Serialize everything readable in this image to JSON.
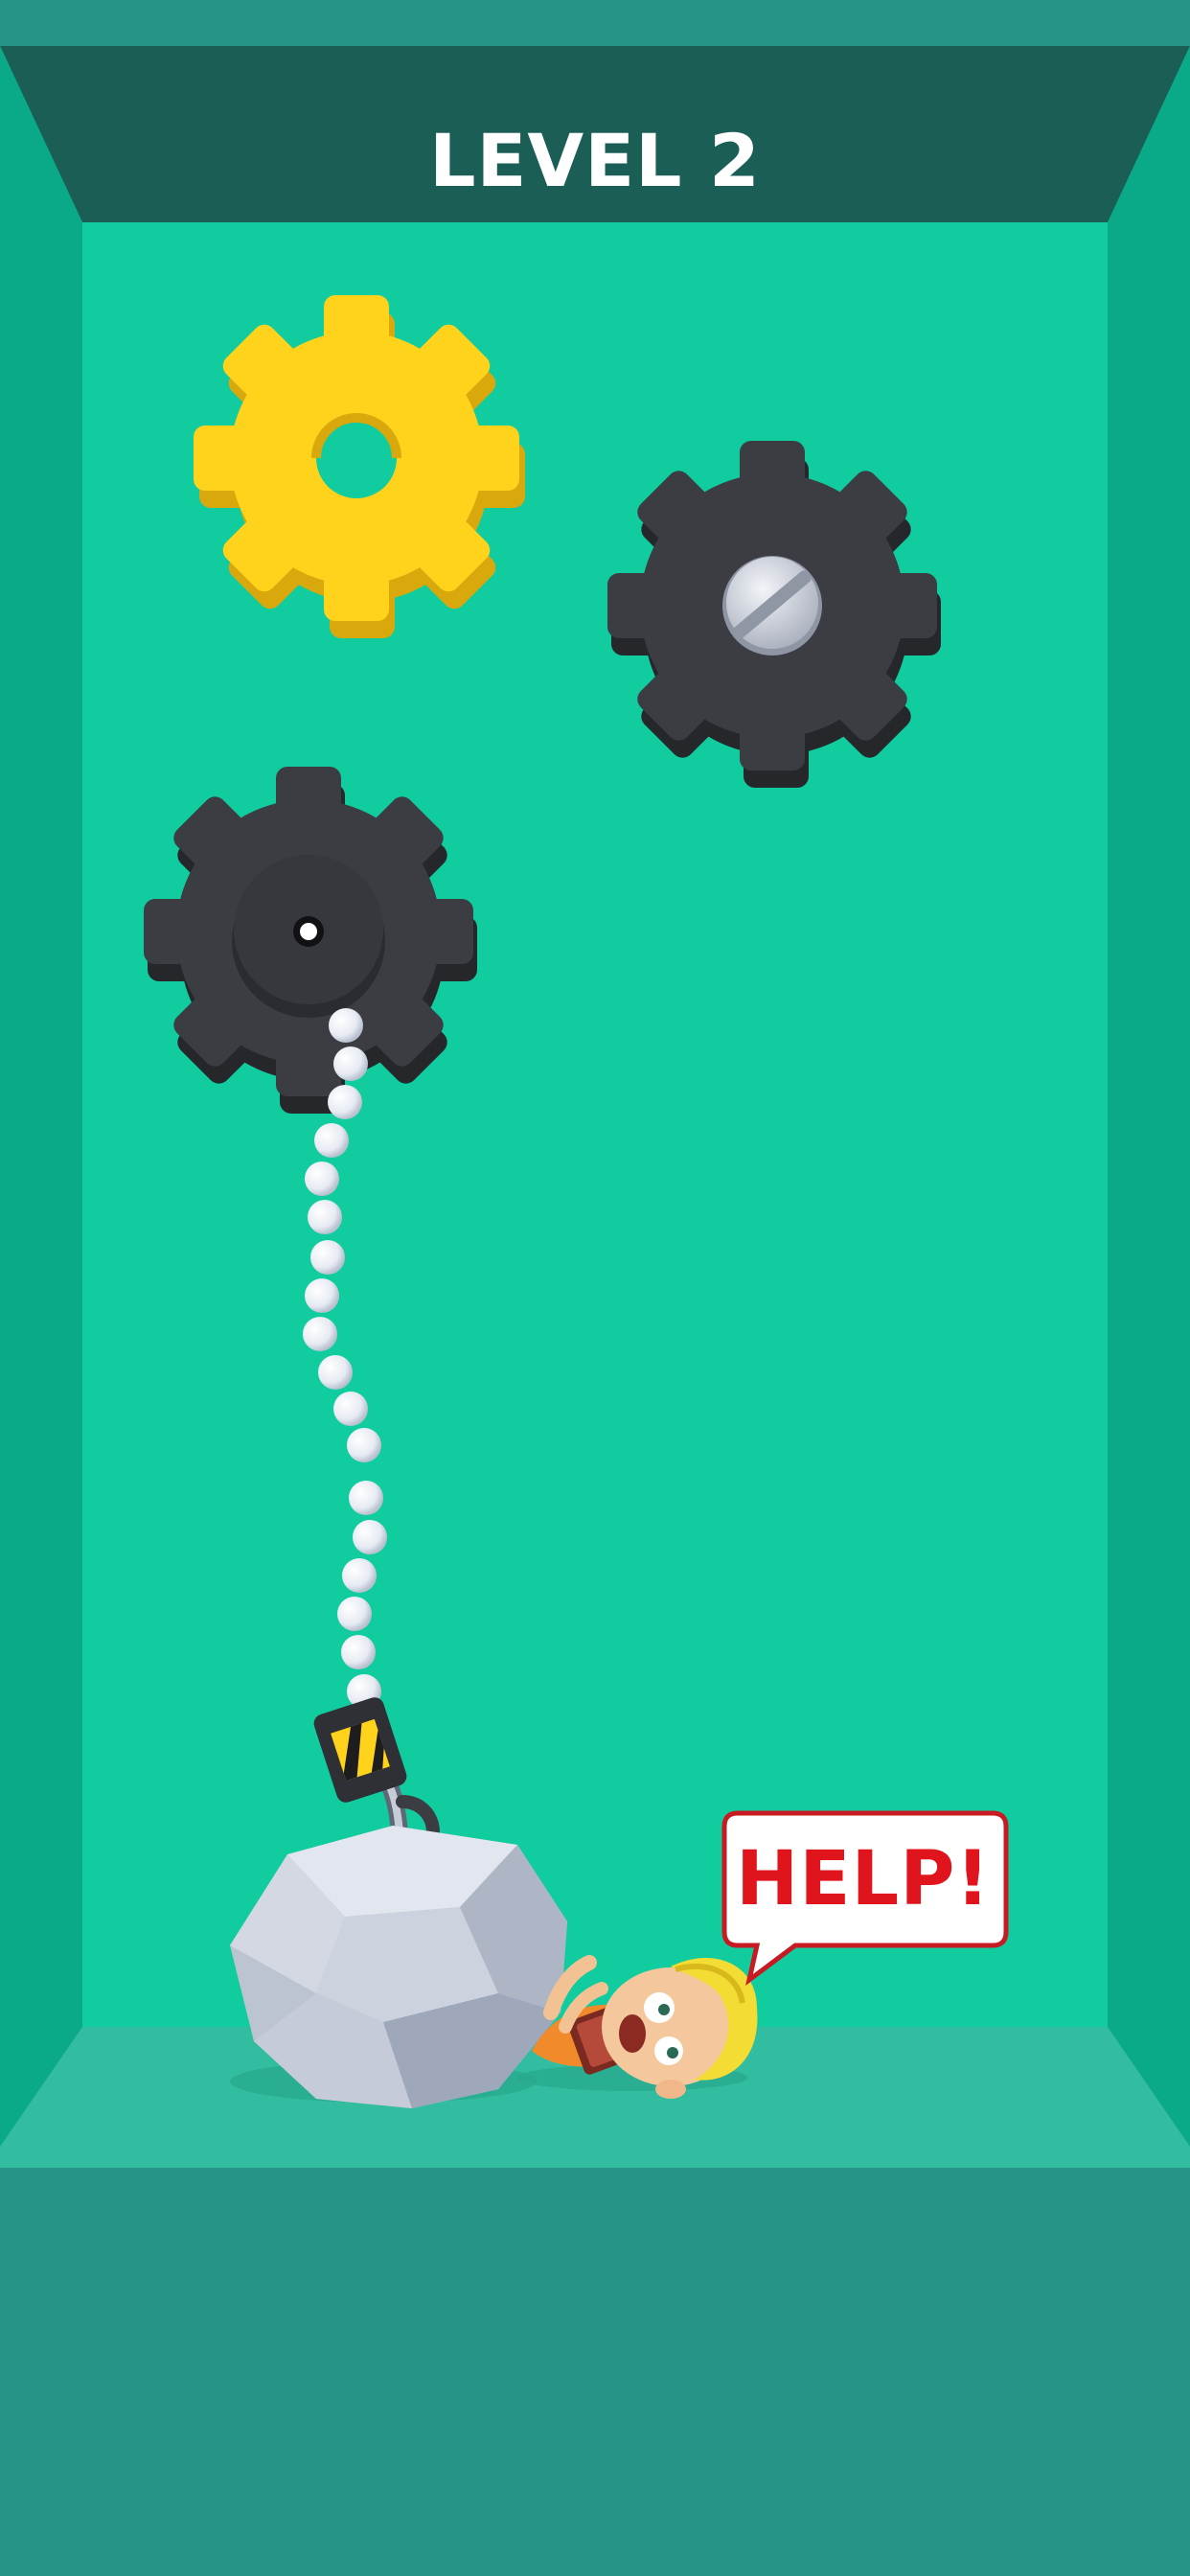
{
  "hud": {
    "level_label": "LEVEL 2"
  },
  "speech_bubble": {
    "text": "HELP!"
  },
  "colors": {
    "room_back_wall": "#11cc9f",
    "room_side_wall": "#0aa987",
    "room_top_band": "#1a5e55",
    "floor": "#32bda1",
    "bottom_area": "#27948a",
    "gear_yellow": "#ffd21c",
    "gear_dark": "#3b3d43",
    "rope_bead": "#eef1f6",
    "boulder": "#d3d8e3",
    "help_text": "#e0141c"
  },
  "objects": {
    "gears": [
      {
        "name": "yellow-gear",
        "color": "gear_yellow",
        "center": "hole"
      },
      {
        "name": "dark-gear-screw",
        "color": "gear_dark",
        "center": "screw"
      },
      {
        "name": "dark-gear-pulley",
        "color": "gear_dark",
        "center": "pivot"
      }
    ],
    "rope": {
      "type": "bead-chain",
      "bead_count": 18
    },
    "weight": {
      "type": "boulder"
    },
    "character": {
      "state": "trapped"
    }
  }
}
